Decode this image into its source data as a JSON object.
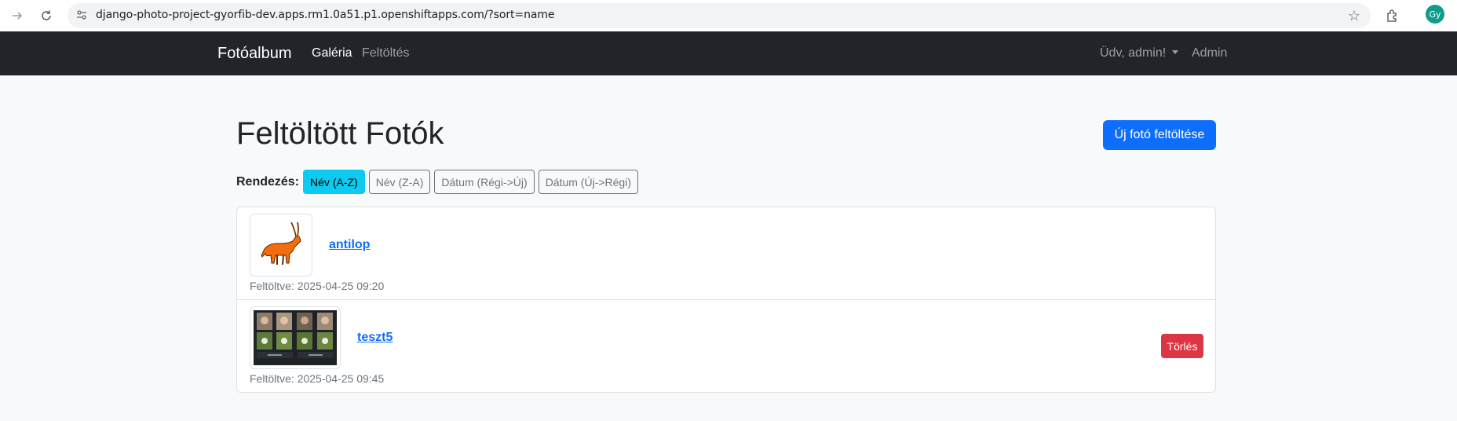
{
  "browser": {
    "url": "django-photo-project-gyorfib-dev.apps.rm1.0a51.p1.openshiftapps.com/?sort=name",
    "profile_initials": "Gy"
  },
  "navbar": {
    "brand": "Fotóalbum",
    "links": [
      {
        "label": "Galéria",
        "active": true
      },
      {
        "label": "Feltöltés",
        "active": false
      }
    ],
    "user_menu": "Üdv, admin!",
    "admin": "Admin"
  },
  "main": {
    "title": "Feltöltött Fotók",
    "upload_button": "Új fotó feltöltése",
    "sort": {
      "label": "Rendezés:",
      "options": [
        {
          "label": "Név (A-Z)",
          "active": true
        },
        {
          "label": "Név (Z-A)",
          "active": false
        },
        {
          "label": "Dátum (Régi->Új)",
          "active": false
        },
        {
          "label": "Dátum (Új->Régi)",
          "active": false
        }
      ]
    },
    "photos": [
      {
        "name": "antilop",
        "uploaded": "Feltöltve: 2025-04-25 09:20",
        "thumbnail": "antelope-illustration"
      },
      {
        "name": "teszt5",
        "uploaded": "Feltöltve: 2025-04-25 09:45",
        "thumbnail": "screenshot-thumbnail",
        "delete_label": "Törlés"
      }
    ]
  },
  "colors": {
    "navbar_bg": "#212529",
    "primary": "#0d6efd",
    "info": "#0dcaf0",
    "danger": "#dc3545",
    "page_bg": "#f8f9fa"
  }
}
